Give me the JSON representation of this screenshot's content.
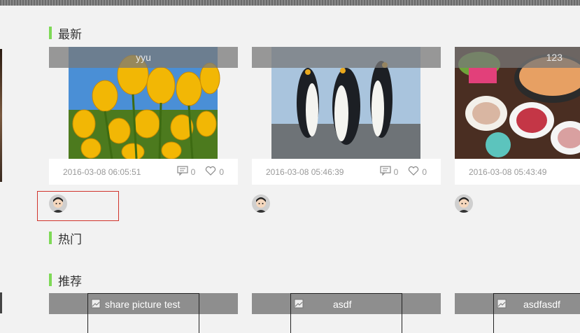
{
  "sections": {
    "latest": "最新",
    "hot": "热门",
    "recommended": "推荐"
  },
  "latest_cards": [
    {
      "title": "yyu",
      "date": "2016-03-08 06:05:51",
      "comments": "0",
      "likes": "0"
    },
    {
      "title": "",
      "date": "2016-03-08 05:46:39",
      "comments": "0",
      "likes": "0"
    },
    {
      "title": "123",
      "date": "2016-03-08 05:43:49",
      "comments": "",
      "likes": ""
    }
  ],
  "recommended_cards": [
    {
      "title": "share picture test"
    },
    {
      "title": "asdf"
    },
    {
      "title": "asdfasdf"
    }
  ],
  "colors": {
    "background": "#f2f2f2",
    "section_accent": "#7ed957",
    "title_bar": "#8e8e8e",
    "selection_border": "#d0342c"
  },
  "icons": [
    "comment-icon",
    "heart-icon",
    "avatar-icon",
    "broken-image-icon"
  ]
}
